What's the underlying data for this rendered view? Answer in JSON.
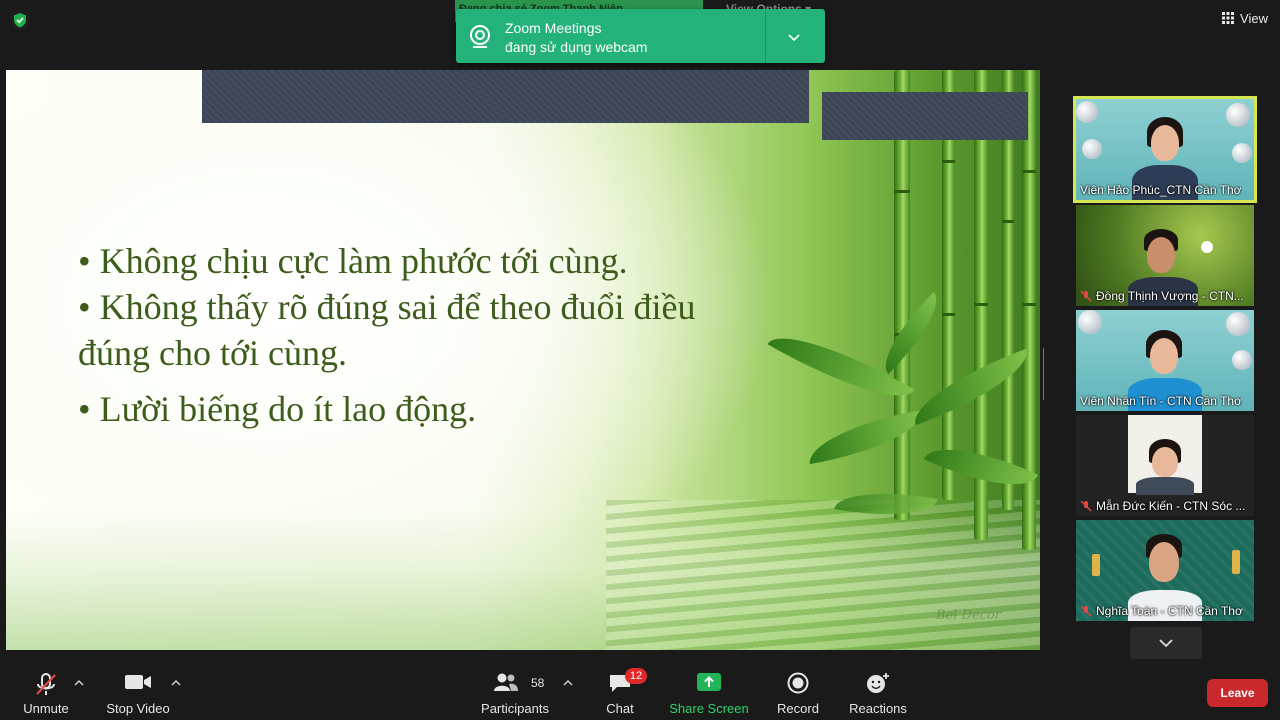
{
  "top_bar": {
    "view_label": "View",
    "share_strip_text": "Đang chia sẻ Zoom Thanh Niên",
    "view_options_label": "View Options ▾"
  },
  "notification": {
    "title": "Zoom Meetings",
    "subtitle": "đang sử dụng webcam"
  },
  "slide": {
    "bullets": [
      "• Không chịu cực làm phước tới cùng.",
      "• Không thấy rõ đúng sai để theo đuổi điều",
      "đúng cho tới cùng.",
      "• Lười biếng do ít lao động."
    ],
    "watermark": "Bel Decor"
  },
  "participants": [
    {
      "name": "Viên Hảo Phúc_CTN Cần Thơ",
      "muted": false,
      "active": true
    },
    {
      "name": "Đồng Thịnh Vượng - CTN...",
      "muted": true,
      "active": false
    },
    {
      "name": "Viên Nhân Tín - CTN Cần Thơ",
      "muted": false,
      "active": false
    },
    {
      "name": "Mẫn Đức Kiến - CTN Sóc ...",
      "muted": true,
      "active": false
    },
    {
      "name": "Nghĩa Toàn - CTN Cần Thơ",
      "muted": true,
      "active": false
    }
  ],
  "toolbar": {
    "unmute_label": "Unmute",
    "stop_video_label": "Stop Video",
    "participants_label": "Participants",
    "participants_count": "58",
    "chat_label": "Chat",
    "chat_badge": "12",
    "share_screen_label": "Share Screen",
    "record_label": "Record",
    "reactions_label": "Reactions",
    "leave_label": "Leave"
  },
  "colors": {
    "share_green": "#23b27a",
    "active_speaker": "#d6e653",
    "leave_red": "#c9282d",
    "slide_text": "#3d5c1c"
  },
  "icons": [
    "shield-icon",
    "grid-icon",
    "webcam-icon",
    "chevron-down-icon",
    "mic-muted-icon",
    "video-camera-icon",
    "participants-icon",
    "chat-icon",
    "share-screen-icon",
    "record-icon",
    "reactions-icon"
  ]
}
